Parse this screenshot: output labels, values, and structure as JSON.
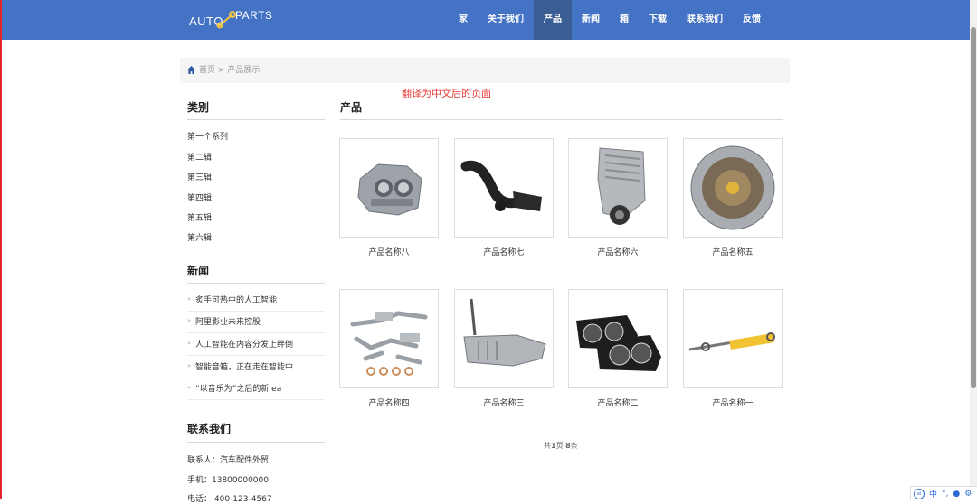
{
  "logo": {
    "left": "AUTO",
    "right": "PARTS"
  },
  "nav": [
    {
      "label": "家",
      "active": false
    },
    {
      "label": "关于我们",
      "active": false
    },
    {
      "label": "产品",
      "active": true
    },
    {
      "label": "新闻",
      "active": false
    },
    {
      "label": "箱",
      "active": false
    },
    {
      "label": "下载",
      "active": false
    },
    {
      "label": "联系我们",
      "active": false
    },
    {
      "label": "反馈",
      "active": false
    }
  ],
  "breadcrumb": {
    "home": "首页",
    "sep": ">",
    "current": "产品展示"
  },
  "note": "翻译为中文后的页面",
  "sidebar": {
    "categories_title": "类别",
    "categories": [
      "第一个系列",
      "第二辑",
      "第三辑",
      "第四辑",
      "第五辑",
      "第六辑"
    ],
    "news_title": "新闻",
    "news": [
      "炙手可热中的人工智能",
      "阿里影业未来控股",
      "人工智能在内容分发上绊倒",
      "智能音箱，正在走在智能中",
      "“以音乐为”之后的新 ea"
    ],
    "contact_title": "联系我们",
    "contact": [
      "联系人：汽车配件外贸",
      "手机：13800000000",
      "电话：  400-123-4567"
    ]
  },
  "main": {
    "title": "产品",
    "products": [
      {
        "name": "产品名称八",
        "icon": "engine-block-icon"
      },
      {
        "name": "产品名称七",
        "icon": "intake-hose-icon"
      },
      {
        "name": "产品名称六",
        "icon": "supercharger-icon"
      },
      {
        "name": "产品名称五",
        "icon": "transmission-housing-icon"
      },
      {
        "name": "产品名称四",
        "icon": "exhaust-kit-icon"
      },
      {
        "name": "产品名称三",
        "icon": "gearbox-icon"
      },
      {
        "name": "产品名称二",
        "icon": "headlight-icon"
      },
      {
        "name": "产品名称一",
        "icon": "shock-absorber-icon"
      }
    ],
    "pagination": {
      "prefix": "共",
      "pages": "1",
      "mid": "页 ",
      "count": "8",
      "suffix": "条"
    }
  },
  "ime": {
    "lang": "中"
  },
  "colors": {
    "header": "#4472c4",
    "active_nav": "#3a5d94",
    "note": "#e53935"
  }
}
